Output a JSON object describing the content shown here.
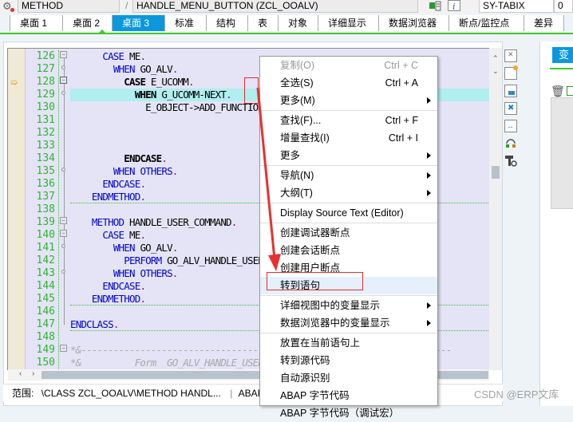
{
  "topbar": {
    "type_field": "METHOD",
    "separator": "/",
    "name_field": "HANDLE_MENU_BUTTON (ZCL_OOALV)",
    "variable_field": "SY-TABIX",
    "value_field": "0"
  },
  "tabs": [
    {
      "label": "桌面 1",
      "active": false
    },
    {
      "label": "桌面 2",
      "active": false
    },
    {
      "label": "桌面 3",
      "active": true
    },
    {
      "label": "标准",
      "active": false
    },
    {
      "label": "结构",
      "active": false
    },
    {
      "label": "表",
      "active": false
    },
    {
      "label": "对象",
      "active": false
    },
    {
      "label": "详细显示",
      "active": false
    },
    {
      "label": "数据浏览器",
      "active": false
    },
    {
      "label": "断点/监控点",
      "active": false
    },
    {
      "label": "差异",
      "active": false
    }
  ],
  "editor": {
    "line_numbers": [
      "126",
      "127",
      "128",
      "129",
      "130",
      "131",
      "132",
      "133",
      "134",
      "135",
      "136",
      "137",
      "138",
      "139",
      "140",
      "141",
      "142",
      "143",
      "144",
      "145",
      "146",
      "147",
      "148",
      "149",
      "150"
    ],
    "current_line": "128",
    "cursor_line": "129",
    "lines": [
      {
        "tokens": [
          {
            "t": "      "
          },
          {
            "c": "kw",
            "t": "CASE"
          },
          {
            "c": "id",
            "t": " ME"
          },
          {
            "c": "dot",
            "t": "."
          }
        ]
      },
      {
        "tokens": [
          {
            "t": "        "
          },
          {
            "c": "kw",
            "t": "WHEN"
          },
          {
            "c": "id",
            "t": " GO_ALV"
          },
          {
            "c": "dot",
            "t": "."
          }
        ]
      },
      {
        "tokens": [
          {
            "t": "          "
          },
          {
            "c": "kwb",
            "t": "CASE"
          },
          {
            "c": "id",
            "t": " E_UCOMM"
          },
          {
            "c": "dot",
            "t": "."
          }
        ]
      },
      {
        "tokens": [
          {
            "t": "            "
          },
          {
            "c": "kwb",
            "t": "WHEN"
          },
          {
            "c": "id",
            "t": " G_UCOMM-NEXT"
          },
          {
            "c": "dot",
            "t": "."
          }
        ]
      },
      {
        "tokens": [
          {
            "t": "              "
          },
          {
            "c": "id",
            "t": "E_OBJECT->ADD_FUNCTION"
          }
        ]
      },
      {
        "tokens": []
      },
      {
        "tokens": []
      },
      {
        "tokens": []
      },
      {
        "tokens": [
          {
            "t": "          "
          },
          {
            "c": "kwb",
            "t": "ENDCASE"
          },
          {
            "c": "dot",
            "t": "."
          }
        ]
      },
      {
        "tokens": [
          {
            "t": "        "
          },
          {
            "c": "kw",
            "t": "WHEN OTHERS"
          },
          {
            "c": "dot",
            "t": "."
          }
        ]
      },
      {
        "tokens": [
          {
            "t": "      "
          },
          {
            "c": "kw",
            "t": "ENDCASE"
          },
          {
            "c": "dot",
            "t": "."
          }
        ]
      },
      {
        "tokens": [
          {
            "t": "    "
          },
          {
            "c": "kw",
            "t": "ENDMETHOD"
          },
          {
            "c": "dot",
            "t": "."
          }
        ]
      },
      {
        "tokens": []
      },
      {
        "tokens": [
          {
            "t": "    "
          },
          {
            "c": "kw",
            "t": "METHOD"
          },
          {
            "c": "id",
            "t": " HANDLE_USER_COMMAND"
          },
          {
            "c": "dot",
            "t": "."
          }
        ]
      },
      {
        "tokens": [
          {
            "t": "      "
          },
          {
            "c": "kw",
            "t": "CASE"
          },
          {
            "c": "id",
            "t": " ME"
          },
          {
            "c": "dot",
            "t": "."
          }
        ]
      },
      {
        "tokens": [
          {
            "t": "        "
          },
          {
            "c": "kw",
            "t": "WHEN"
          },
          {
            "c": "id",
            "t": " GO_ALV"
          },
          {
            "c": "dot",
            "t": "."
          }
        ]
      },
      {
        "tokens": [
          {
            "t": "          "
          },
          {
            "c": "kw",
            "t": "PERFORM"
          },
          {
            "c": "id",
            "t": " GO_ALV_HANDLE_USER_COMMAND USING E_UCOMM"
          },
          {
            "c": "dot",
            "t": "."
          }
        ]
      },
      {
        "tokens": [
          {
            "t": "        "
          },
          {
            "c": "kw",
            "t": "WHEN OTHERS"
          },
          {
            "c": "dot",
            "t": "."
          }
        ]
      },
      {
        "tokens": [
          {
            "t": "      "
          },
          {
            "c": "kw",
            "t": "ENDCASE"
          },
          {
            "c": "dot",
            "t": "."
          }
        ]
      },
      {
        "tokens": [
          {
            "t": "    "
          },
          {
            "c": "kw",
            "t": "ENDMETHOD"
          },
          {
            "c": "dot",
            "t": "."
          }
        ]
      },
      {
        "tokens": []
      },
      {
        "tokens": [
          {
            "c": "kw",
            "t": "ENDCLASS"
          },
          {
            "c": "dot",
            "t": "."
          }
        ]
      },
      {
        "tokens": []
      },
      {
        "tokens": [
          {
            "c": "cm",
            "t": "*&---------------------------------------------------------------------"
          }
        ]
      },
      {
        "tokens": [
          {
            "c": "cm",
            "t": "*&          Form  GO_ALV_HANDLE_USER_COMMAND"
          }
        ]
      }
    ]
  },
  "status": {
    "scope_label": "范围:",
    "scope_value": "\\CLASS ZCL_OOALV\\METHOD HANDL...",
    "separator": "|",
    "lang": "ABAP"
  },
  "right_panel": {
    "tab_label": "变量"
  },
  "context_menu": {
    "items": [
      {
        "label": "复制(O)",
        "shortcut": "Ctrl + C",
        "disabled": true
      },
      {
        "label": "全选(S)",
        "shortcut": "Ctrl + A"
      },
      {
        "label": "更多(M)",
        "submenu": true
      },
      {
        "sep": true
      },
      {
        "label": "查找(F)...",
        "shortcut": "Ctrl + F"
      },
      {
        "label": "增量查找(I)",
        "shortcut": "Ctrl + I"
      },
      {
        "label": "更多",
        "submenu": true
      },
      {
        "sep": true
      },
      {
        "label": "导航(N)",
        "submenu": true
      },
      {
        "label": "大纲(T)",
        "submenu": true
      },
      {
        "sep": true
      },
      {
        "label": "Display Source Text (Editor)"
      },
      {
        "sep": true
      },
      {
        "label": "创建调试器断点"
      },
      {
        "label": "创建会话断点"
      },
      {
        "label": "创建用户断点"
      },
      {
        "label": "转到语句",
        "highlighted": true
      },
      {
        "sep": true
      },
      {
        "label": "详细视图中的变量显示",
        "submenu": true
      },
      {
        "label": "数据浏览器中的变量显示",
        "submenu": true
      },
      {
        "sep": true
      },
      {
        "label": "放置在当前语句上"
      },
      {
        "label": "转到源代码"
      },
      {
        "label": "自动源识别"
      },
      {
        "label": "ABAP 字节代码"
      },
      {
        "label": "ABAP 字节代码（调试宏）"
      }
    ]
  },
  "watermark": "CSDN @ERP文库"
}
